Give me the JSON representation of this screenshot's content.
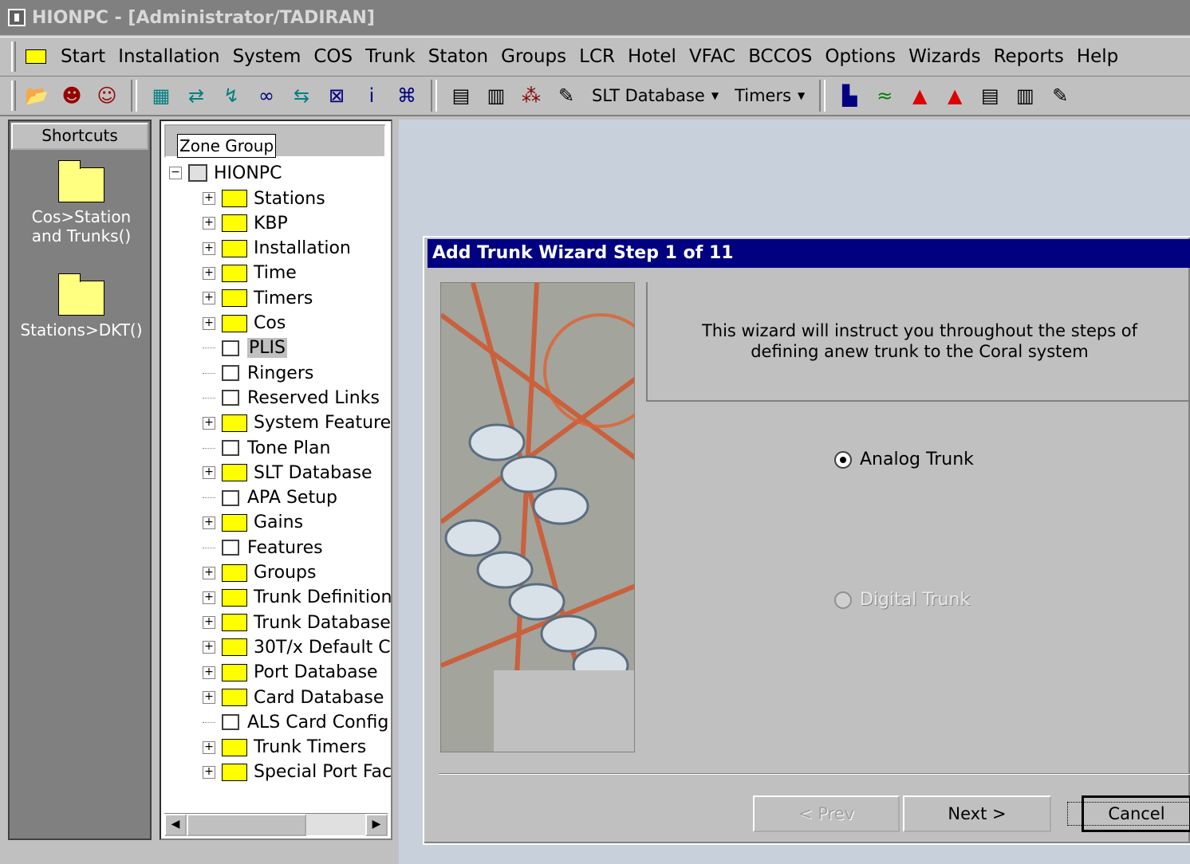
{
  "window": {
    "title": "HIONPC - [Administrator/TADIRAN]"
  },
  "menubar": {
    "items": [
      "Start",
      "Installation",
      "System",
      "COS",
      "Trunk",
      "Staton",
      "Groups",
      "LCR",
      "Hotel",
      "VFAC",
      "BCCOS",
      "Options",
      "Wizards",
      "Reports",
      "Help"
    ]
  },
  "toolbar": {
    "slt_label": "SLT Database",
    "timers_label": "Timers",
    "icons": [
      "open-icon",
      "user-icon",
      "users-icon",
      "tree-icon",
      "trunk-icon",
      "route-icon",
      "link-icon",
      "network-icon",
      "cross-icon",
      "info-icon",
      "chart-icon",
      "station-icon",
      "grid-icon",
      "config-icon",
      "tool-icon",
      "bar-chart-icon",
      "line-chart-icon",
      "warning-icon",
      "alert-icon",
      "doc-icon",
      "list-icon",
      "wrench-icon"
    ]
  },
  "shortcuts": {
    "header": "Shortcuts",
    "items": [
      {
        "label": "Cos>Station and Trunks()"
      },
      {
        "label": "Stations>DKT()"
      }
    ]
  },
  "tree": {
    "zone_label": "Zone Group",
    "root": "HIONPC",
    "nodes": [
      {
        "label": "Stations",
        "type": "folder",
        "expandable": true
      },
      {
        "label": "KBP",
        "type": "folder",
        "expandable": true
      },
      {
        "label": "Installation",
        "type": "folder",
        "expandable": true
      },
      {
        "label": "Time",
        "type": "folder",
        "expandable": true
      },
      {
        "label": "Timers",
        "type": "folder",
        "expandable": true
      },
      {
        "label": "Cos",
        "type": "folder",
        "expandable": true
      },
      {
        "label": "PLIS",
        "type": "doc",
        "expandable": false,
        "selected": true
      },
      {
        "label": "Ringers",
        "type": "doc",
        "expandable": false
      },
      {
        "label": "Reserved Links",
        "type": "doc",
        "expandable": false
      },
      {
        "label": "System Features",
        "type": "folder",
        "expandable": true
      },
      {
        "label": "Tone Plan",
        "type": "doc",
        "expandable": false
      },
      {
        "label": "SLT Database",
        "type": "folder",
        "expandable": true
      },
      {
        "label": "APA Setup",
        "type": "doc",
        "expandable": false
      },
      {
        "label": "Gains",
        "type": "folder",
        "expandable": true
      },
      {
        "label": "Features",
        "type": "doc",
        "expandable": false
      },
      {
        "label": "Groups",
        "type": "folder",
        "expandable": true
      },
      {
        "label": "Trunk Definitions",
        "type": "folder",
        "expandable": true
      },
      {
        "label": "Trunk Database",
        "type": "folder",
        "expandable": true
      },
      {
        "label": "30T/x Default C",
        "type": "folder",
        "expandable": true
      },
      {
        "label": "Port Database",
        "type": "folder",
        "expandable": true
      },
      {
        "label": "Card Database",
        "type": "folder",
        "expandable": true
      },
      {
        "label": "ALS Card Config",
        "type": "doc",
        "expandable": false
      },
      {
        "label": "Trunk Timers",
        "type": "folder",
        "expandable": true
      },
      {
        "label": "Special Port Fac",
        "type": "folder",
        "expandable": true
      }
    ]
  },
  "wizard": {
    "title": "Add Trunk Wizard   Step 1 of 11",
    "intro_line1": "This wizard will instruct you throughout the steps of",
    "intro_line2": "defining anew trunk to the  Coral system",
    "options": [
      {
        "label": "Analog Trunk",
        "selected": true,
        "enabled": true
      },
      {
        "label": "Digital Trunk",
        "selected": false,
        "enabled": false
      }
    ],
    "buttons": {
      "prev": "< Prev",
      "next": "Next >",
      "cancel": "Cancel"
    }
  }
}
